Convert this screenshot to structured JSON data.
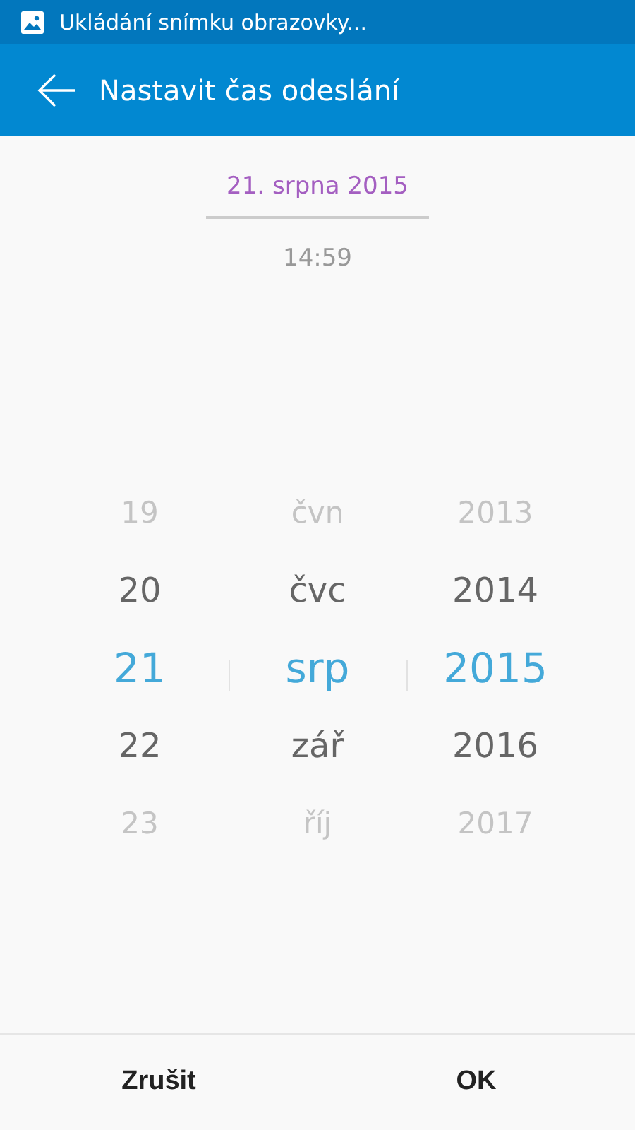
{
  "status_bar": {
    "notification": "Ukládání snímku obrazovky..."
  },
  "app_bar": {
    "title": "Nastavit čas odeslání"
  },
  "tabs": [
    {
      "label": "21. srpna 2015",
      "selected": true
    },
    {
      "label": "14:59",
      "selected": false
    }
  ],
  "picker": {
    "columns": [
      {
        "items": [
          {
            "label": "19",
            "selected": false
          },
          {
            "label": "20",
            "selected": false
          },
          {
            "label": "21",
            "selected": true
          },
          {
            "label": "22",
            "selected": false
          },
          {
            "label": "23",
            "selected": false
          }
        ]
      },
      {
        "items": [
          {
            "label": "čvn",
            "selected": false
          },
          {
            "label": "čvc",
            "selected": false
          },
          {
            "label": "srp",
            "selected": true
          },
          {
            "label": "zář",
            "selected": false
          },
          {
            "label": "říj",
            "selected": false
          }
        ]
      },
      {
        "items": [
          {
            "label": "2013",
            "selected": false
          },
          {
            "label": "2014",
            "selected": false
          },
          {
            "label": "2015",
            "selected": true
          },
          {
            "label": "2016",
            "selected": false
          },
          {
            "label": "2017",
            "selected": false
          }
        ]
      }
    ]
  },
  "buttons": [
    "Zrušit",
    "OK"
  ]
}
